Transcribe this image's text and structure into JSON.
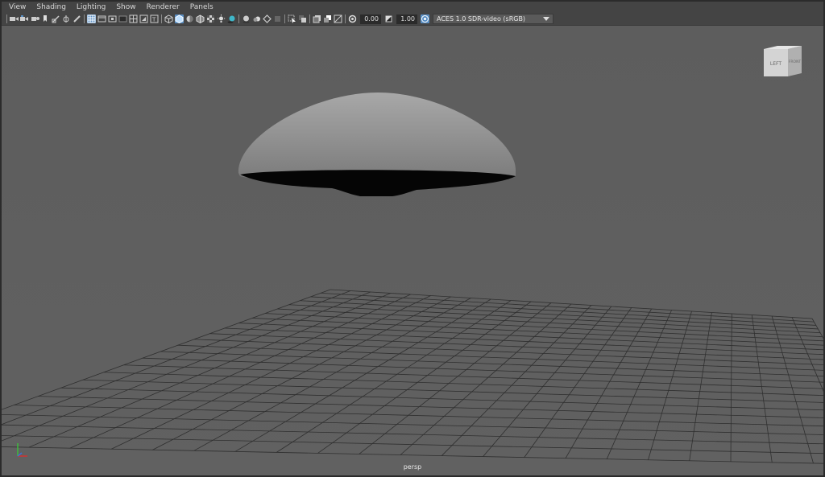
{
  "menu": [
    "View",
    "Shading",
    "Lighting",
    "Show",
    "Renderer",
    "Panels"
  ],
  "toolbar": {
    "exposure": "0.00",
    "gamma": "1.00",
    "color_management": "ACES 1.0 SDR-video (sRGB)"
  },
  "view_cube": {
    "left": "LEFT",
    "front": "FRONT"
  },
  "camera": "persp",
  "colors": {
    "background": "#5d5d5d",
    "toolbar": "#444444",
    "active": "#5a8fc4"
  }
}
